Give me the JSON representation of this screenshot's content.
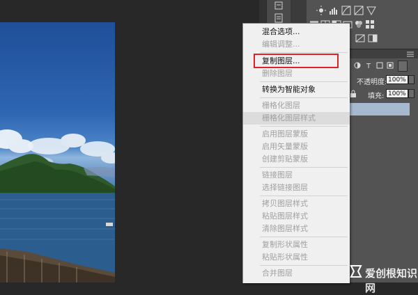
{
  "context_menu": {
    "items": [
      {
        "label": "混合选项...",
        "enabled": true
      },
      {
        "label": "编辑调整...",
        "enabled": false
      },
      {
        "separator": true
      },
      {
        "label": "复制图层...",
        "enabled": true
      },
      {
        "label": "删除图层",
        "enabled": false
      },
      {
        "separator": true
      },
      {
        "label": "转换为智能对象",
        "enabled": true
      },
      {
        "separator": true
      },
      {
        "label": "栅格化图层",
        "enabled": false
      },
      {
        "label": "栅格化图层样式",
        "enabled": false
      },
      {
        "separator": true
      },
      {
        "label": "启用图层蒙版",
        "enabled": false
      },
      {
        "label": "启用矢量蒙版",
        "enabled": false
      },
      {
        "label": "创建剪贴蒙版",
        "enabled": false
      },
      {
        "separator": true
      },
      {
        "label": "链接图层",
        "enabled": false
      },
      {
        "label": "选择链接图层",
        "enabled": false
      },
      {
        "separator": true
      },
      {
        "label": "拷贝图层样式",
        "enabled": false
      },
      {
        "label": "粘贴图层样式",
        "enabled": false
      },
      {
        "label": "清除图层样式",
        "enabled": false
      },
      {
        "separator": true
      },
      {
        "label": "复制形状属性",
        "enabled": false
      },
      {
        "label": "粘贴形状属性",
        "enabled": false
      },
      {
        "separator": true
      },
      {
        "label": "合并图层",
        "enabled": false
      }
    ],
    "highlighted_label": "复制图层...",
    "highlight_color": "#e2202a"
  },
  "layers_panel": {
    "opacity_label": "不透明度:",
    "opacity_value": "100%",
    "fill_label": "填充:",
    "fill_value": "100%"
  },
  "watermark": {
    "text": "爱创根知识网"
  }
}
